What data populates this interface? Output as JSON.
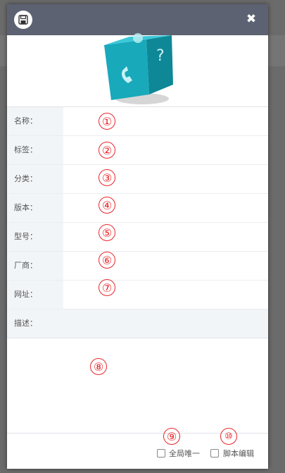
{
  "dialog": {
    "title_icon": "save-icon",
    "close_icon": "close-icon",
    "close_label": "✖"
  },
  "form": {
    "fields": [
      {
        "label": "名称：",
        "marker": "①"
      },
      {
        "label": "标签：",
        "marker": "②"
      },
      {
        "label": "分类：",
        "marker": "③"
      },
      {
        "label": "版本：",
        "marker": "④"
      },
      {
        "label": "型号：",
        "marker": "⑤"
      },
      {
        "label": "厂商：",
        "marker": "⑥"
      },
      {
        "label": "网址：",
        "marker": "⑦"
      }
    ],
    "description": {
      "label": "描述：",
      "marker": "⑧"
    }
  },
  "footer": {
    "global_unique": {
      "label": "全局唯一",
      "marker": "⑨",
      "checked": false
    },
    "script_edit": {
      "label": "脚本编辑",
      "marker": "⑩",
      "checked": false
    }
  },
  "colors": {
    "titlebar": "#5d6272",
    "marker": "#e8262b",
    "label_bg": "#f2f5f8",
    "cube": "#1fb3c6"
  }
}
